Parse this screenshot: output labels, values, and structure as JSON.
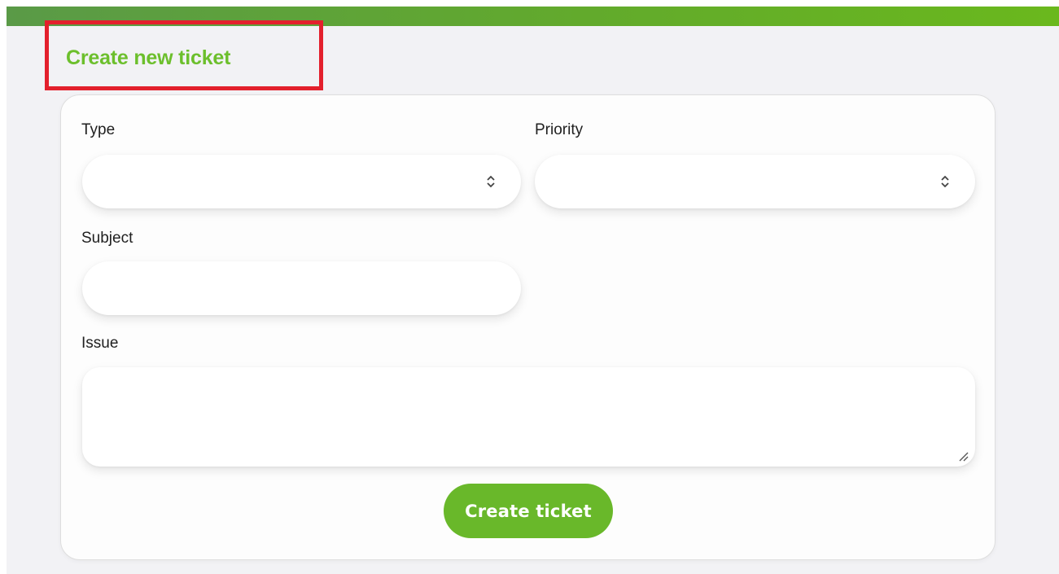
{
  "header": {
    "title": "Create new ticket"
  },
  "form": {
    "type": {
      "label": "Type",
      "value": ""
    },
    "priority": {
      "label": "Priority",
      "value": ""
    },
    "subject": {
      "label": "Subject",
      "value": ""
    },
    "issue": {
      "label": "Issue",
      "value": ""
    },
    "submit_label": "Create ticket"
  },
  "colors": {
    "brand_green": "#69b82a",
    "title_green": "#6cbf2c",
    "highlight_red": "#e3202c"
  },
  "icons": {
    "select": "chevron-up-down-icon",
    "resize": "resize-handle-icon"
  }
}
